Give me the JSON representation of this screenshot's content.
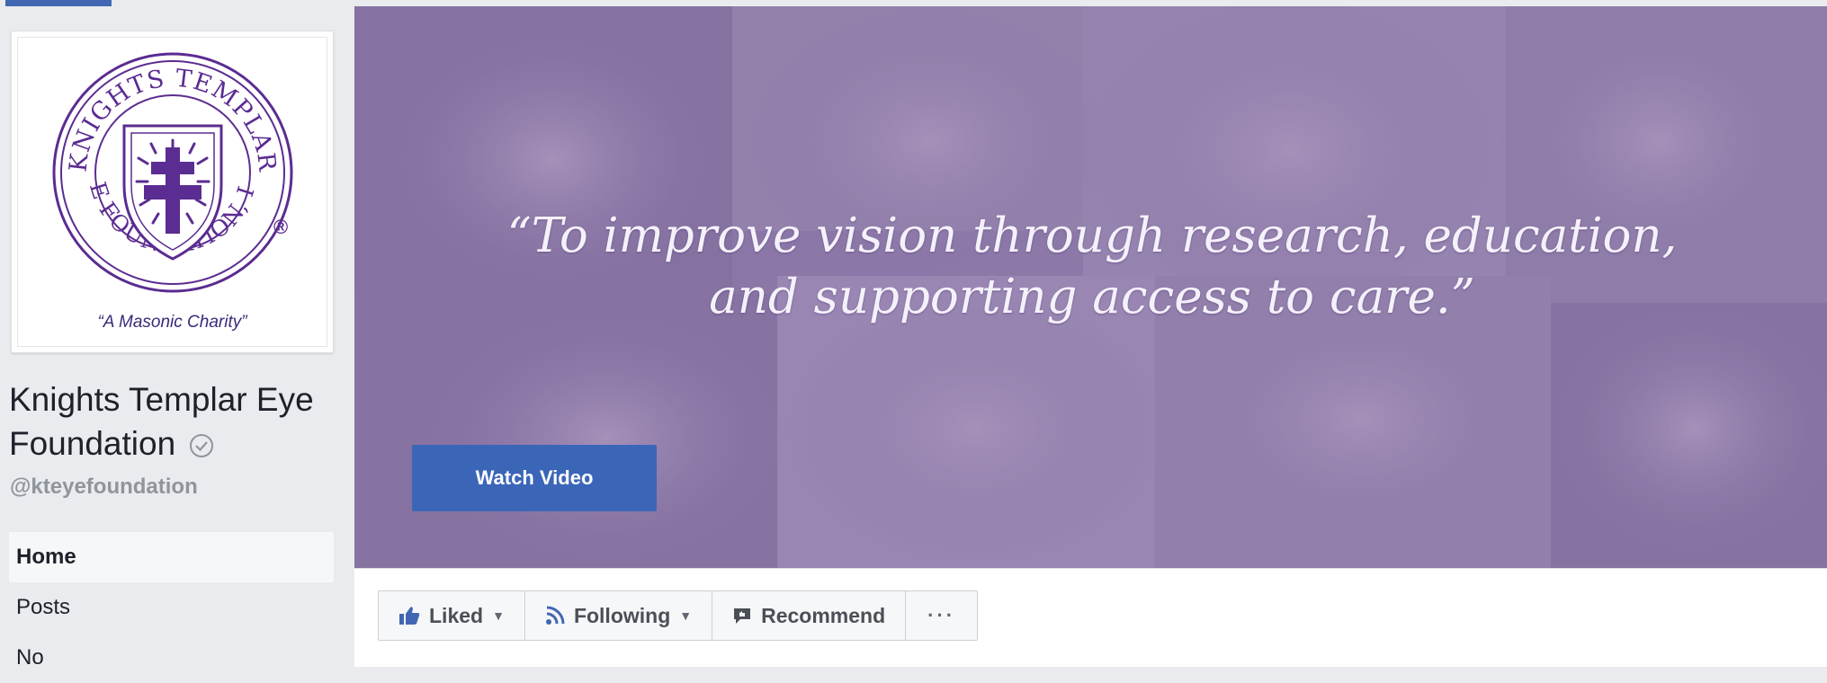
{
  "page": {
    "name": "Knights Templar Eye Foundation",
    "handle": "@kteyefoundation",
    "verified": true
  },
  "logo": {
    "charity_text": "“A Masonic Charity”",
    "top_arc": "KNIGHTS TEMPLAR",
    "bottom_arc": "EYE FOUNDATION, Inc.",
    "registered_mark": "®"
  },
  "nav": {
    "items": [
      {
        "label": "Home",
        "active": true
      },
      {
        "label": "Posts",
        "active": false
      },
      {
        "label": "No",
        "active": false
      }
    ]
  },
  "cover": {
    "quote_line1": "“To improve vision through research, education,",
    "quote_line2": "and supporting access to care.”",
    "watch_video_label": "Watch Video"
  },
  "actions": {
    "liked_label": "Liked",
    "following_label": "Following",
    "recommend_label": "Recommend",
    "more_label": "···"
  },
  "colors": {
    "brand_blue": "#4267b2",
    "logo_purple": "#5b2c91",
    "cover_tint": "#8b7fa8"
  },
  "icons": [
    "verified-icon",
    "thumbs-up-icon",
    "rss-feed-icon",
    "recommend-bubble-icon",
    "caret-down-icon",
    "more-dots-icon"
  ]
}
